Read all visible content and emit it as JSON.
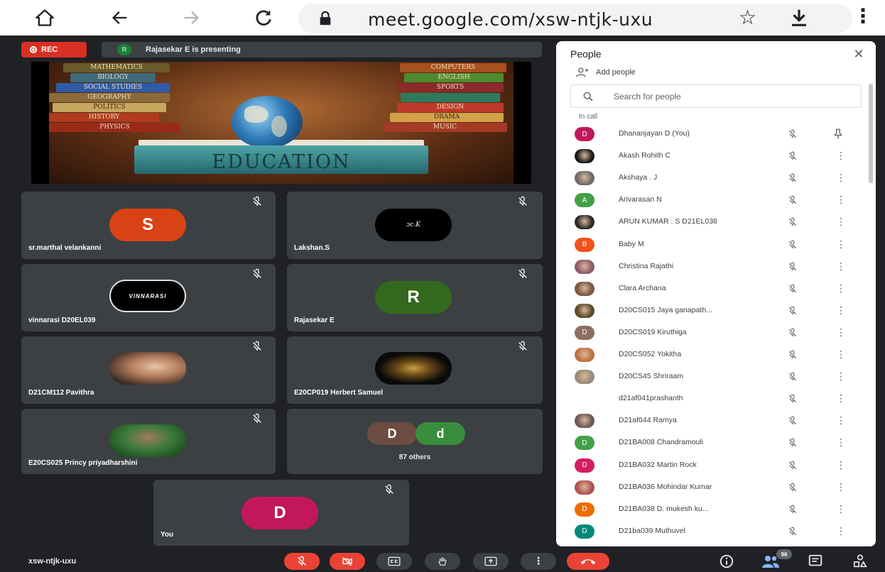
{
  "browser": {
    "url": "meet.google.com/xsw-ntjk-uxu",
    "icons": [
      "home-icon",
      "back-icon",
      "forward-icon",
      "reload-icon",
      "lock-icon",
      "star-icon",
      "download-icon",
      "more-vert-icon"
    ]
  },
  "meeting": {
    "rec_label": "REC",
    "presenter_initial": "R",
    "presenting_text": "Rajasekar E is presenting",
    "slide": {
      "title": "EDUCATION",
      "book_labels": [
        "MATHEMATICS",
        "BIOLOGY",
        "SOCIAL STUDIES",
        "GEOGRAPHY",
        "POLITICS",
        "HISTORY",
        "PHYSICS",
        "COMPUTERS",
        "ENGLISH",
        "SPORTS",
        "DESIGN",
        "DRAMA",
        "MUSIC"
      ]
    },
    "tiles": [
      {
        "name": "sr.marthal velankanni",
        "initial": "S",
        "color": "#d84315"
      },
      {
        "name": "Lakshan.S",
        "avatar_text": "ɔc.K"
      },
      {
        "name": "vinnarasi D20EL039",
        "avatar_text": "VINNARASI"
      },
      {
        "name": "Rajasekar E",
        "initial": "R",
        "color": "#33691e"
      },
      {
        "name": "D21CM112 Pavithra"
      },
      {
        "name": "E20CP019 Herbert Samuel"
      },
      {
        "name": "E20CS025 Princy priyadharshini"
      },
      {
        "name": "87 others",
        "initials": [
          "D",
          "d"
        ],
        "colors": [
          "#6d4c41",
          "#388e3c"
        ]
      },
      {
        "name": "You",
        "initial": "D",
        "color": "#c2185b"
      }
    ]
  },
  "bottom_bar": {
    "meeting_code": "xsw-ntjk-uxu",
    "people_count": "96"
  },
  "people_panel": {
    "title": "People",
    "add_people": "Add people",
    "search_placeholder": "Search for people",
    "section_label": "In call",
    "participants": [
      {
        "name": "Dhananjayan D (You)",
        "initial": "D",
        "color": "#c2185b",
        "pinned_icon": true
      },
      {
        "name": "Akash Rohith C",
        "photo": "#1a1a1a"
      },
      {
        "name": "Akshaya . J",
        "photo": "#6d6a68"
      },
      {
        "name": "Arivarasan N",
        "initial": "A",
        "color": "#43a047"
      },
      {
        "name": "ARUN KUMAR . S D21EL038",
        "photo": "#2a2a2a"
      },
      {
        "name": "Baby M",
        "initial": "B",
        "color": "#f4511e"
      },
      {
        "name": "Christina Rajathi",
        "photo": "#8e5a6a"
      },
      {
        "name": "Clara Archana",
        "photo": "#7a5542"
      },
      {
        "name": "D20CS015 Jaya ganapath...",
        "photo": "#5a4a2a"
      },
      {
        "name": "D20CS019 Kiruthiga",
        "initial": "D",
        "color": "#8d6e63"
      },
      {
        "name": "D20CS052 Yokitha",
        "photo": "#c07040"
      },
      {
        "name": "D20CS45 Shriraam",
        "photo": "#9a8a7a"
      },
      {
        "name": "d21af041prashanth",
        "blank": true
      },
      {
        "name": "D21af044 Ramya",
        "photo": "#6a5a55"
      },
      {
        "name": "D21BA008 Chandramouli",
        "initial": "D",
        "color": "#43a047"
      },
      {
        "name": "D21BA032 Martin Rock",
        "initial": "D",
        "color": "#d81b60"
      },
      {
        "name": "D21BA036 Mohindar Kumar",
        "photo": "#b05050"
      },
      {
        "name": "D21BA038 D. mukesh ku...",
        "initial": "D",
        "color": "#ef6c00"
      },
      {
        "name": "D21ba039 Muthuvel",
        "initial": "D",
        "color": "#00897b"
      }
    ]
  }
}
